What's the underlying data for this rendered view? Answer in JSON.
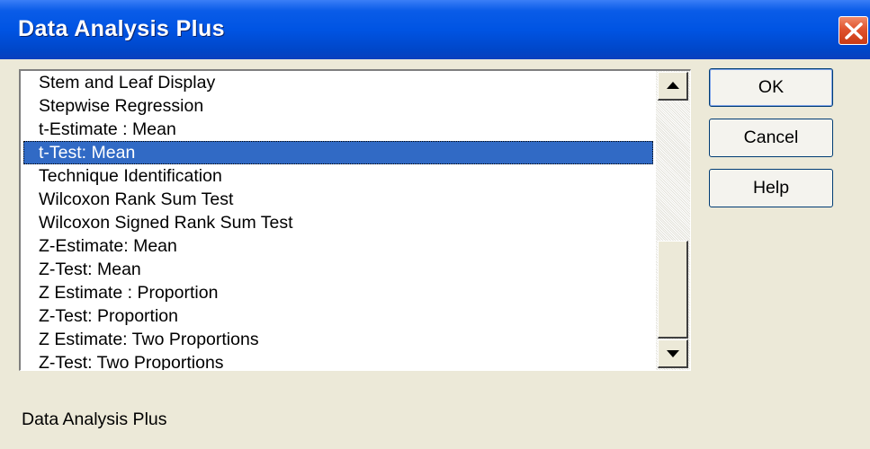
{
  "window": {
    "title": "Data Analysis Plus"
  },
  "list": {
    "items": [
      "Stem and Leaf Display",
      "Stepwise Regression",
      "t-Estimate : Mean",
      "t-Test: Mean",
      "Technique Identification",
      "Wilcoxon Rank Sum Test",
      "Wilcoxon Signed Rank Sum Test",
      "Z-Estimate: Mean",
      "Z-Test: Mean",
      "Z Estimate : Proportion",
      "Z-Test: Proportion",
      "Z Estimate: Two Proportions",
      "Z-Test: Two Proportions"
    ],
    "selected": "t-Test: Mean"
  },
  "buttons": {
    "ok": "OK",
    "cancel": "Cancel",
    "help": "Help"
  },
  "status": {
    "text": "Data Analysis Plus"
  },
  "icons": {
    "close": "close-icon",
    "scroll_up": "scroll-up-arrow-icon",
    "scroll_down": "scroll-down-arrow-icon"
  },
  "colors": {
    "titlebar": "#0054E3",
    "selection": "#316AC5",
    "close_button": "#E0532E",
    "dialog_bg": "#ECE9D8"
  }
}
